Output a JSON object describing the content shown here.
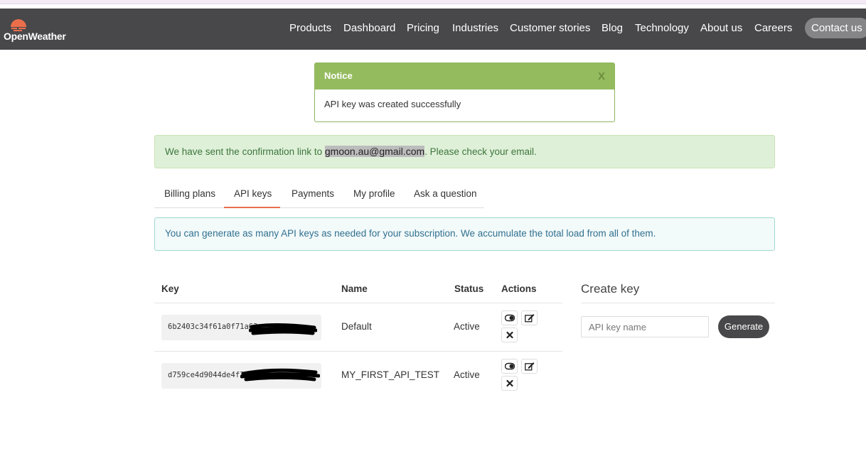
{
  "brand": {
    "name": "OpenWeather",
    "accent": "#eb6e4b"
  },
  "nav": {
    "items": [
      {
        "label": "Products",
        "name": "nav-products"
      },
      {
        "label": "Dashboard",
        "name": "nav-dashboard"
      },
      {
        "label": "Pricing",
        "name": "nav-pricing"
      },
      {
        "label": "Industries",
        "name": "nav-industries"
      },
      {
        "label": "Customer stories",
        "name": "nav-customer-stories"
      },
      {
        "label": "Blog",
        "name": "nav-blog"
      },
      {
        "label": "Technology",
        "name": "nav-technology"
      },
      {
        "label": "About us",
        "name": "nav-about-us"
      },
      {
        "label": "Careers",
        "name": "nav-careers"
      }
    ],
    "contact_label": "Contact us"
  },
  "notice": {
    "title": "Notice",
    "close": "X",
    "message": "API key was created successfully"
  },
  "confirmation": {
    "prefix": "We have sent the confirmation link to ",
    "email": "gmoon.au@gmail.com",
    "suffix": ". Please check your email."
  },
  "tabs": [
    {
      "label": "Billing plans"
    },
    {
      "label": "API keys",
      "active": true
    },
    {
      "label": "Payments"
    },
    {
      "label": "My profile"
    },
    {
      "label": "Ask a question"
    }
  ],
  "info": "You can generate as many API keys as needed for your subscription. We accumulate the total load from all of them.",
  "table": {
    "headers": {
      "key": "Key",
      "name": "Name",
      "status": "Status",
      "actions": "Actions"
    },
    "rows": [
      {
        "key": "6b2403c34f61a0f71a63",
        "name": "Default",
        "status": "Active"
      },
      {
        "key": "d759ce4d9044de4f3",
        "name": "MY_FIRST_API_TEST",
        "status": "Active"
      }
    ]
  },
  "create": {
    "title": "Create key",
    "placeholder": "API key name",
    "button": "Generate"
  }
}
